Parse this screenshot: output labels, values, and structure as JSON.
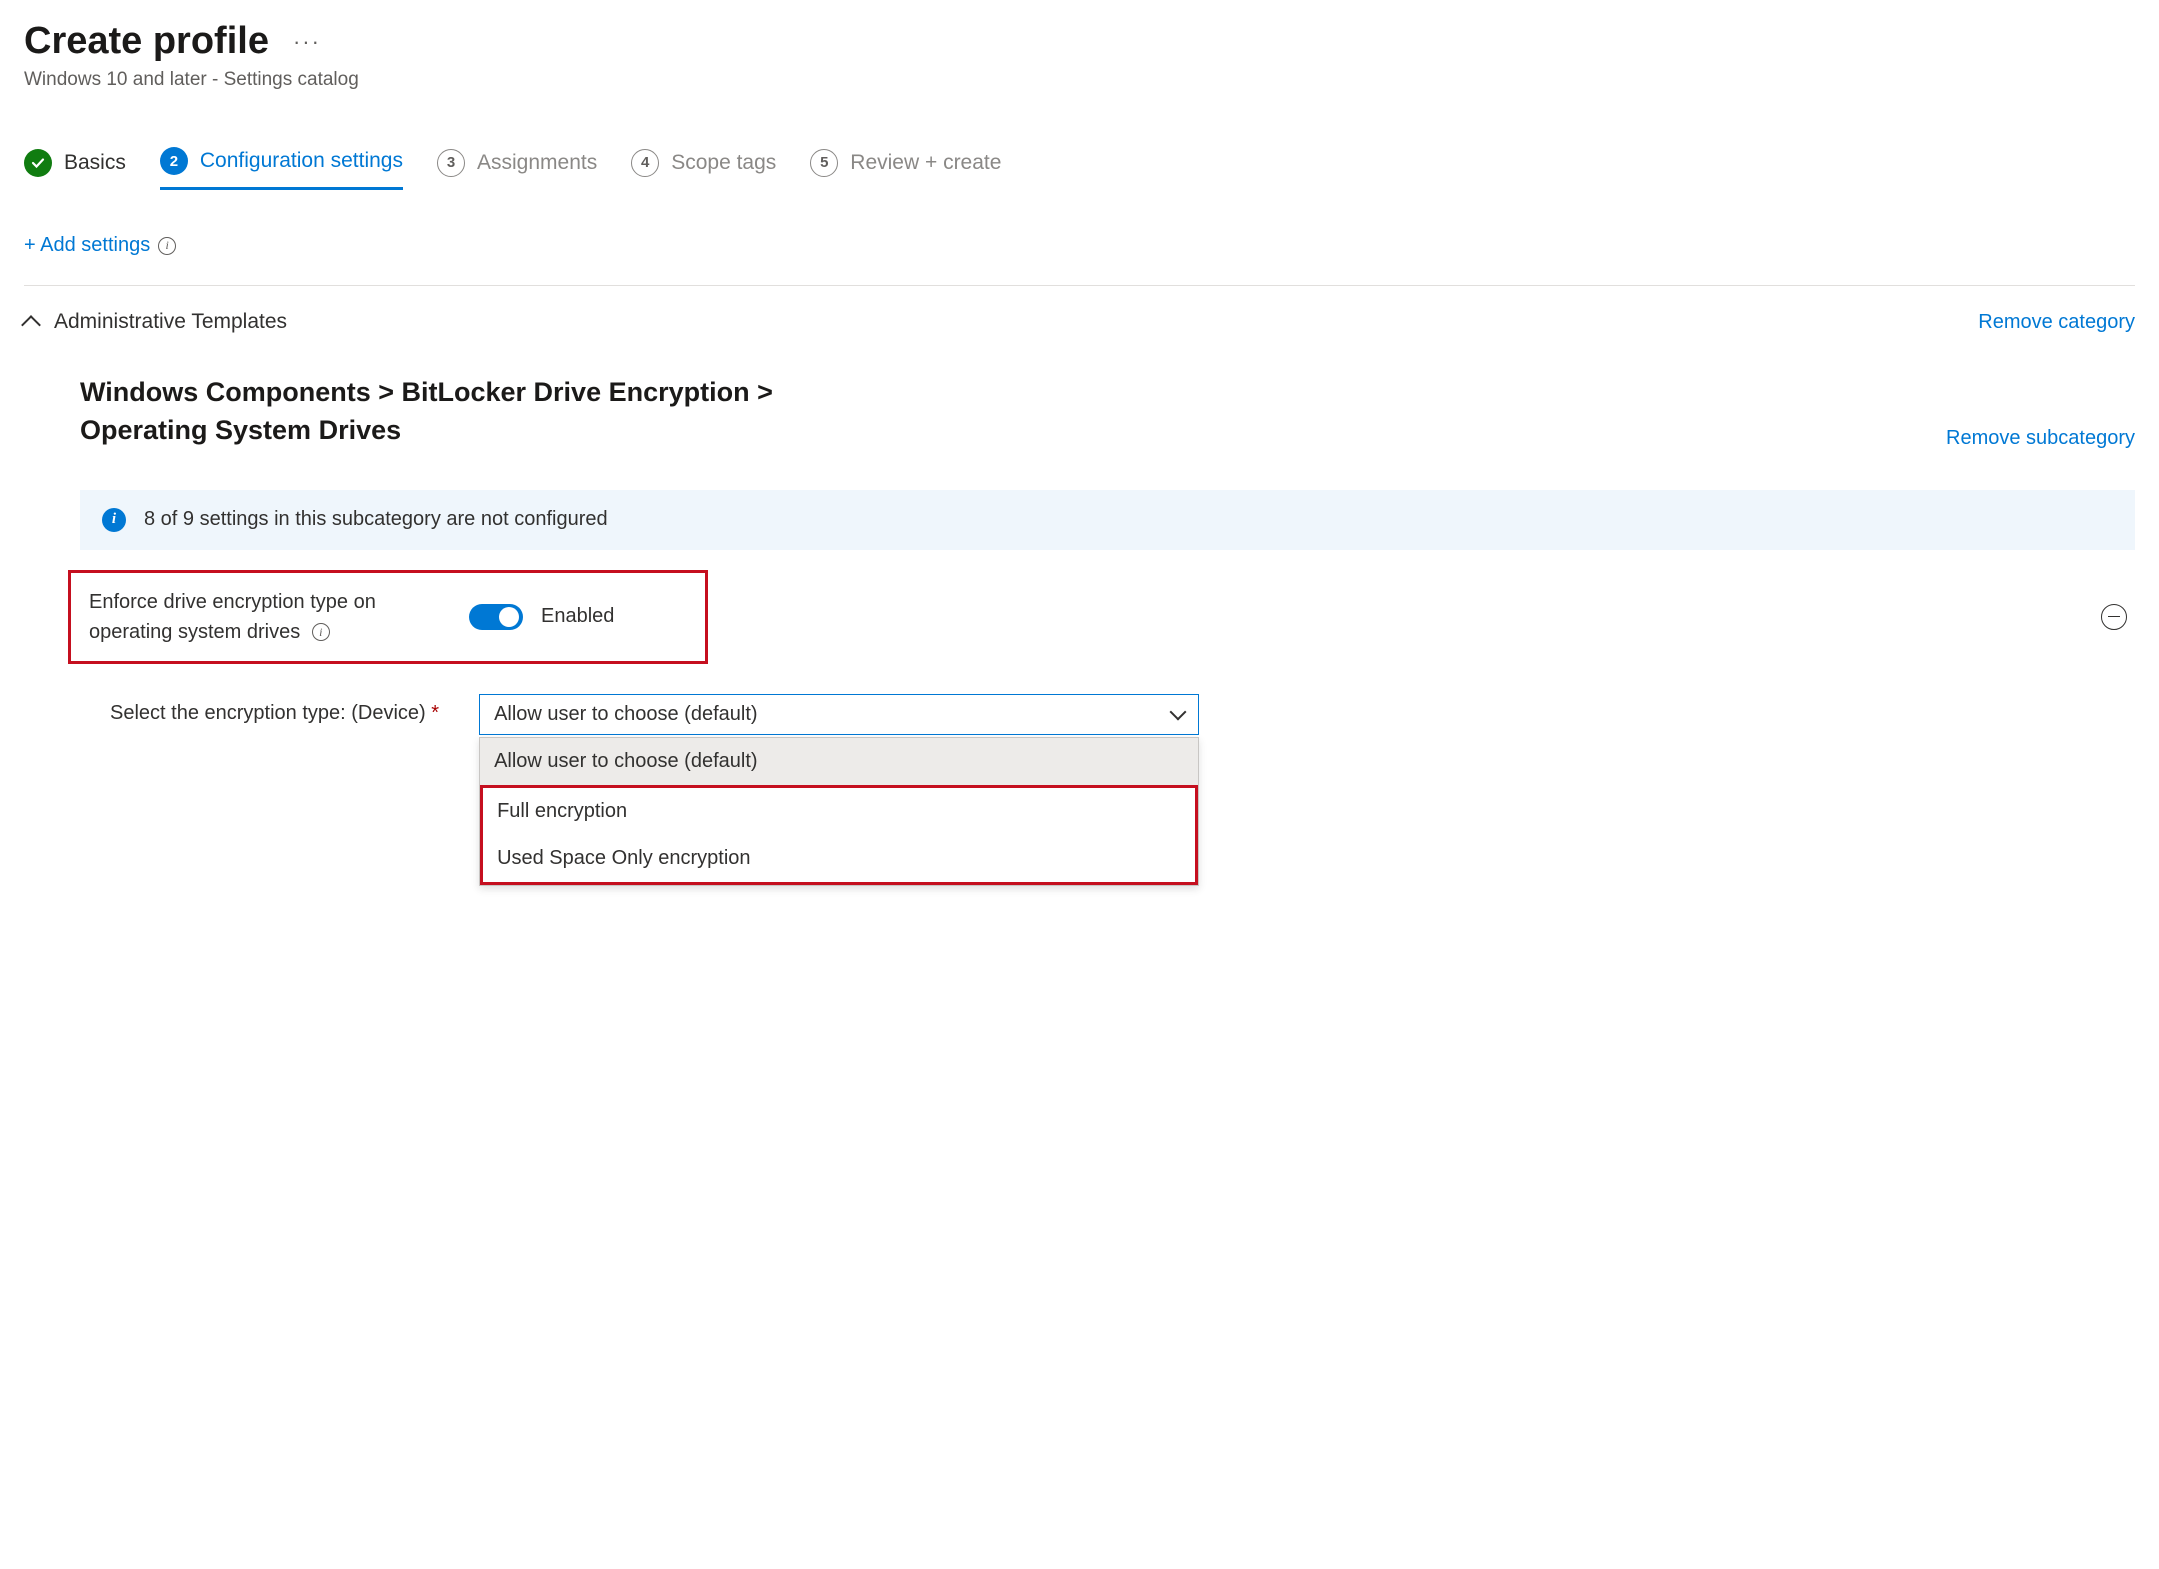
{
  "header": {
    "title": "Create profile",
    "ellipsis": "···",
    "subtitle": "Windows 10 and later - Settings catalog"
  },
  "stepper": {
    "steps": [
      {
        "num": "✓",
        "label": "Basics",
        "state": "done"
      },
      {
        "num": "2",
        "label": "Configuration settings",
        "state": "current"
      },
      {
        "num": "3",
        "label": "Assignments",
        "state": "pending"
      },
      {
        "num": "4",
        "label": "Scope tags",
        "state": "pending"
      },
      {
        "num": "5",
        "label": "Review + create",
        "state": "pending"
      }
    ]
  },
  "actions": {
    "add_settings": "+ Add settings"
  },
  "category": {
    "name": "Administrative Templates",
    "remove": "Remove category"
  },
  "subcategory": {
    "breadcrumb": "Windows Components > BitLocker Drive Encryption > Operating System Drives",
    "remove": "Remove subcategory"
  },
  "banner": {
    "text": "8 of 9 settings in this subcategory are not configured"
  },
  "setting": {
    "label": "Enforce drive encryption type on operating system drives",
    "state_label": "Enabled",
    "enabled": true
  },
  "dropdown": {
    "label": "Select the encryption type: (Device)",
    "required_marker": "*",
    "selected": "Allow user to choose (default)",
    "options": [
      "Allow user to choose (default)",
      "Full encryption",
      "Used Space Only encryption"
    ]
  }
}
